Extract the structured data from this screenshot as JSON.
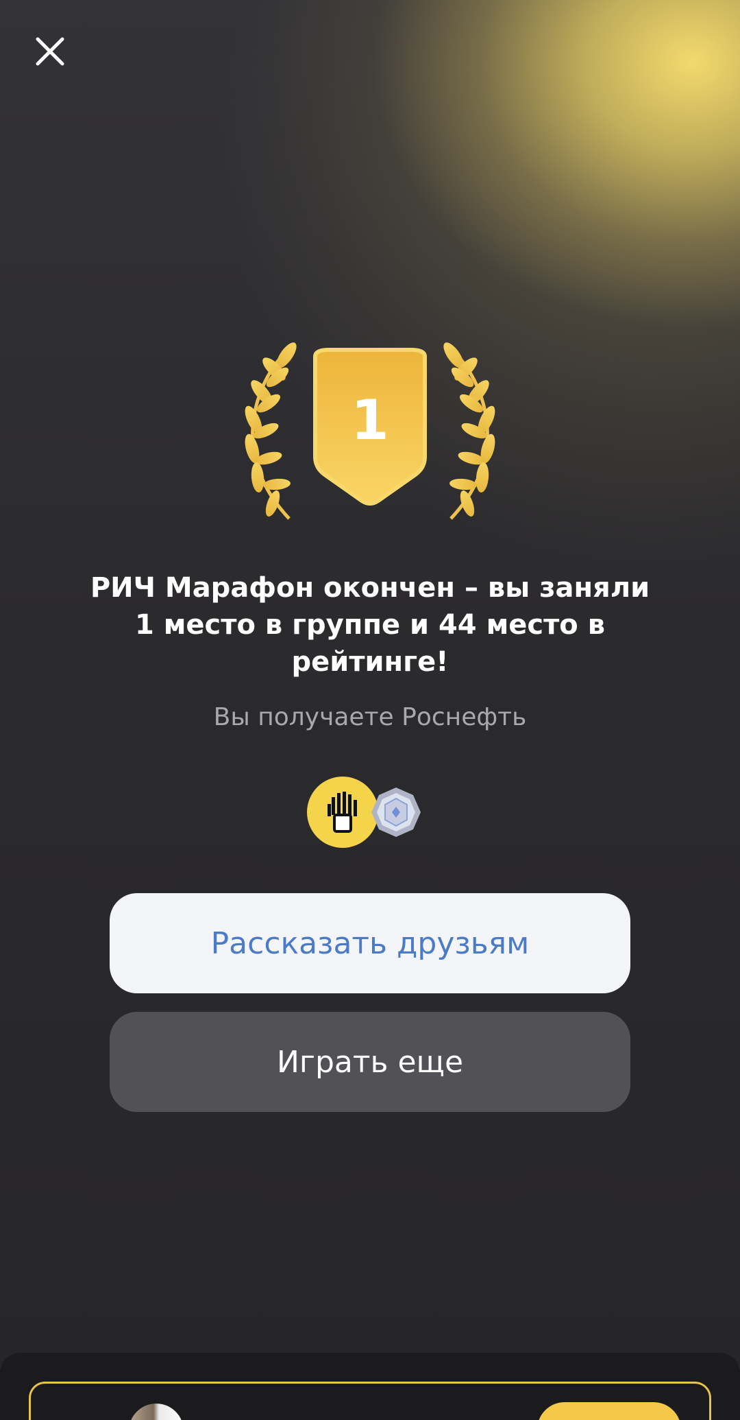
{
  "header": {
    "close_icon": "close-icon"
  },
  "badge": {
    "place": "1",
    "icon": "laurel-wreath-icon",
    "color": "#f2c348"
  },
  "result": {
    "headline": "РИЧ Марафон окончен – вы заняли 1 место в группе и 44 место в рейтинге!",
    "subtitle": "Вы получаете Роснефть"
  },
  "rewards": [
    {
      "icon": "rosneft-logo-icon",
      "color": "#f4d44a"
    },
    {
      "icon": "diamond-gem-icon",
      "color": "#c9cfe0"
    }
  ],
  "buttons": {
    "share_label": "Рассказать друзьям",
    "play_label": "Играть еще"
  },
  "colors": {
    "accent": "#f4c94a",
    "share_text": "#4b7bc6",
    "background": "#2a292c"
  }
}
